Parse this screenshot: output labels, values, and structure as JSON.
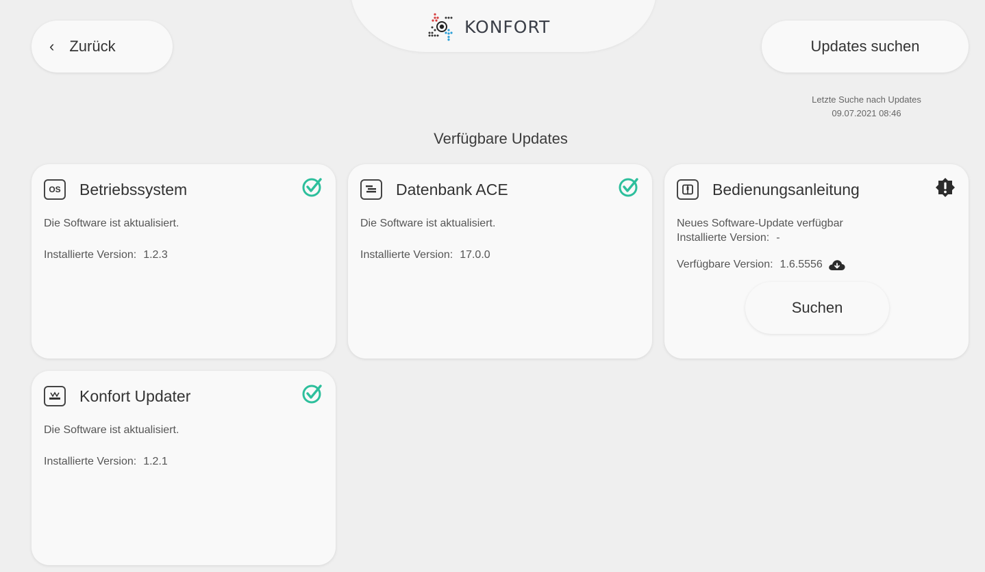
{
  "header": {
    "back_label": "Zurück",
    "logo_text": "KONFORT",
    "updates_button": "Updates suchen",
    "last_search_label": "Letzte Suche nach Updates",
    "last_search_date": "09.07.2021 08:46"
  },
  "section_title": "Verfügbare Updates",
  "colors": {
    "check": "#2dbf9c",
    "warning": "#2c2c2c",
    "background": "#efefef",
    "card": "#f9f9f9"
  },
  "cards": [
    {
      "title": "Betriebssystem",
      "icon": "os-icon",
      "icon_text": "OS",
      "status": "up-to-date",
      "status_text": "Die Software ist aktualisiert.",
      "installed_label": "Installierte Version:",
      "installed_version": "1.2.3"
    },
    {
      "title": "Datenbank ACE",
      "icon": "database-icon",
      "status": "up-to-date",
      "status_text": "Die Software ist aktualisiert.",
      "installed_label": "Installierte Version:",
      "installed_version": "17.0.0"
    },
    {
      "title": "Bedienungsanleitung",
      "icon": "manual-icon",
      "status": "update-available",
      "status_text": "Neues Software-Update verfügbar",
      "installed_label": "Installierte Version:",
      "installed_version": "-",
      "available_label": "Verfügbare Version:",
      "available_version": "1.6.5556",
      "action_label": "Suchen"
    },
    {
      "title": "Konfort Updater",
      "icon": "updater-icon",
      "status": "up-to-date",
      "status_text": "Die Software ist aktualisiert.",
      "installed_label": "Installierte Version:",
      "installed_version": "1.2.1"
    }
  ]
}
